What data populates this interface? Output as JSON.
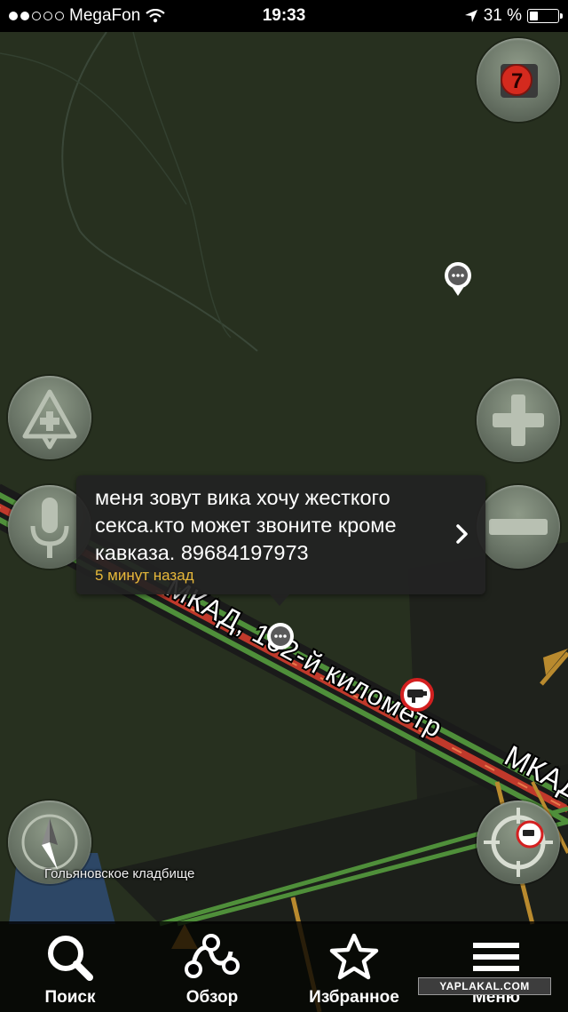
{
  "status_bar": {
    "signal_dots_filled": 2,
    "signal_dots_total": 5,
    "carrier": "MegaFon",
    "time": "19:33",
    "battery_percent": "31 %",
    "battery_level": 0.31
  },
  "map": {
    "road_label_1": "МКАД, 102-й километр",
    "road_label_2": "МКАД",
    "place_label": "Гольяновское кладбище"
  },
  "traffic_light_badge": "7",
  "popup": {
    "message": "меня зовут вика хочу жесткого секса.кто может звоните кроме кавказа. 89684197973",
    "time_ago": "5 минут назад"
  },
  "tabs": [
    {
      "label": "Поиск",
      "icon": "search-icon"
    },
    {
      "label": "Обзор",
      "icon": "overview-route-icon"
    },
    {
      "label": "Избранное",
      "icon": "star-icon"
    },
    {
      "label": "Меню",
      "icon": "menu-icon"
    }
  ],
  "watermark": "YAPLAKAL.COM",
  "colors": {
    "map_background": "#27301f",
    "traffic_red": "#c0392b",
    "road_green": "#4f8f3a",
    "time_ago": "#e8b83a"
  }
}
